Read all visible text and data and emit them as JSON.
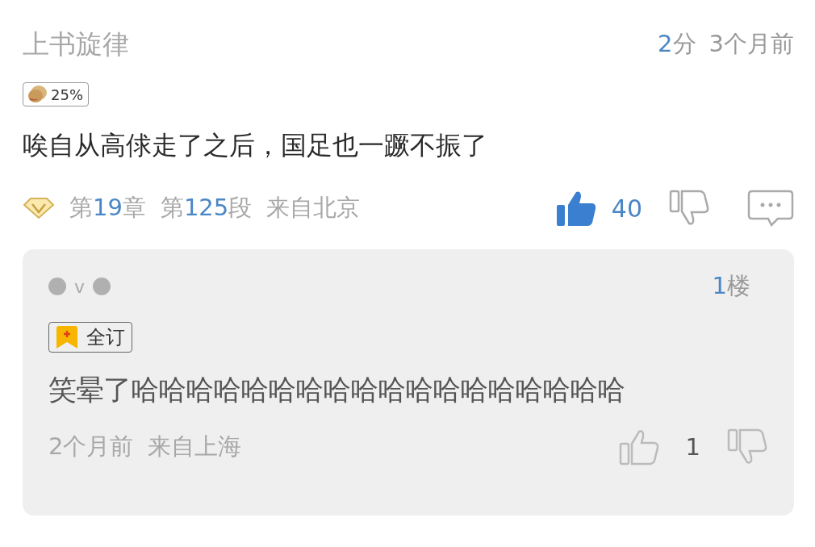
{
  "comment": {
    "user": "上书旋律",
    "score": {
      "value": "2",
      "unit": "分"
    },
    "time": "3个月前",
    "badge": {
      "text": "25%"
    },
    "text": "唉自从高俅走了之后，国足也一蹶不振了",
    "chapter": {
      "prefix": "第",
      "number": "19",
      "suffix": "章"
    },
    "paragraph": {
      "prefix": "第",
      "number": "125",
      "suffix": "段"
    },
    "location": "来自北京",
    "likes": "40",
    "liked": true
  },
  "reply": {
    "user_middle": "v",
    "floor": {
      "number": "1",
      "suffix": "楼"
    },
    "badge": {
      "text": "全订"
    },
    "text": "笑晕了哈哈哈哈哈哈哈哈哈哈哈哈哈哈哈哈哈哈",
    "time": "2个月前",
    "location": "来自上海",
    "likes": "1",
    "liked": false
  }
}
